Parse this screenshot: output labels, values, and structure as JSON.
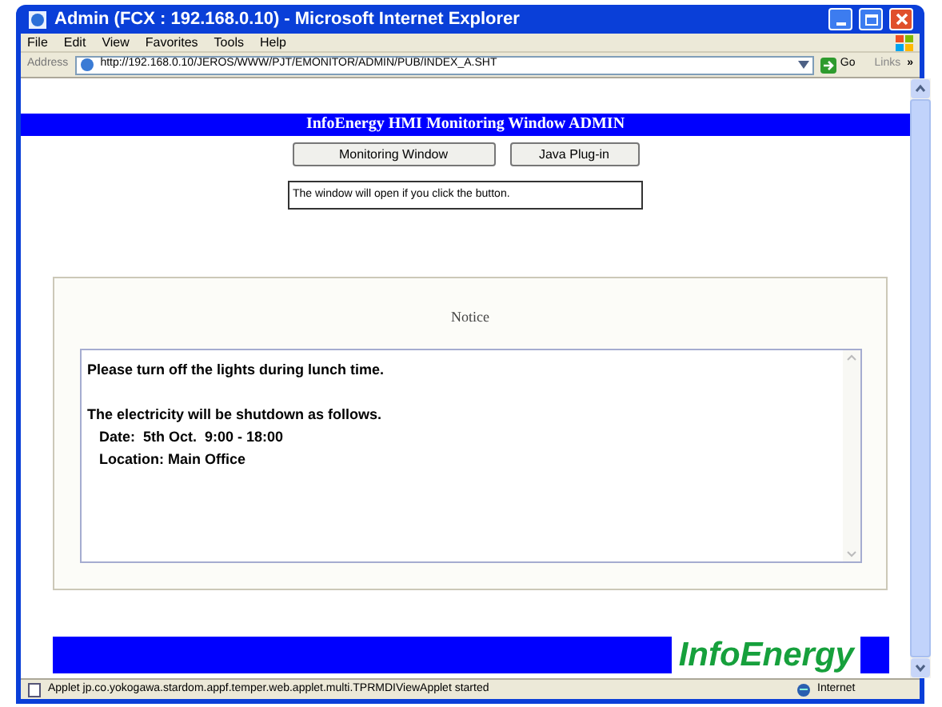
{
  "window": {
    "title": "Admin (FCX : 192.168.0.10) - Microsoft Internet Explorer"
  },
  "menu": [
    "File",
    "Edit",
    "View",
    "Favorites",
    "Tools",
    "Help"
  ],
  "address_bar": {
    "label": "Address",
    "url": "http://192.168.0.10/JEROS/WWW/PJT/EMONITOR/ADMIN/PUB/INDEX_A.SHT",
    "go": "Go",
    "links": "Links",
    "more": "»"
  },
  "page": {
    "header": "InfoEnergy HMI Monitoring Window ADMIN",
    "buttons": [
      "Monitoring Window",
      "Java Plug-in"
    ],
    "message": "The window will open if you click the button.",
    "notice": {
      "title": "Notice",
      "paragraphs": [
        [
          "Please turn off the lights during lunch time."
        ],
        [
          "The electricity will be shutdown as follows.",
          "   Date:  5th Oct.  9:00 - 18:00",
          "   Location: Main Office"
        ]
      ]
    },
    "footer_logo": "InfoEnergy"
  },
  "status_bar": {
    "text": "Applet jp.co.yokogawa.stardom.appf.temper.web.applet.multi.TPRMDIViewApplet started",
    "zone": "Internet"
  }
}
